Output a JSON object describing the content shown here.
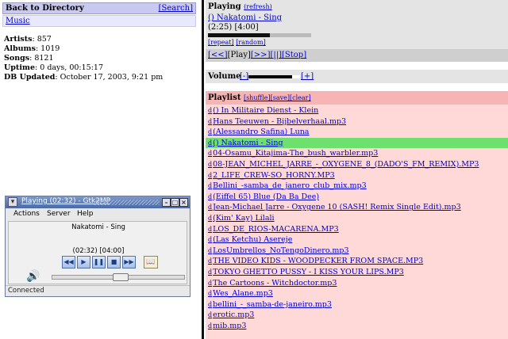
{
  "directory": {
    "back_label": "Back to Directory",
    "search_label": "[Search]",
    "music_label": "Music"
  },
  "stats": [
    {
      "label": "Artists",
      "value": ": 857"
    },
    {
      "label": "Albums",
      "value": ": 1019"
    },
    {
      "label": "Songs",
      "value": ": 8121"
    },
    {
      "label": "Uptime",
      "value": ": 0 days, 00:15:17"
    },
    {
      "label": "DB Updated",
      "value": ": October 17, 2003, 9:21 pm"
    }
  ],
  "gtk2mp": {
    "window_title": "Playing (02:32) - Gtk2MP",
    "menu": [
      "Actions",
      "Server",
      "Help"
    ],
    "track": "Nakatomi - Sing",
    "time": "(02:32) [04:00]",
    "status": "Connected",
    "volume_level": 0.52
  },
  "playing": {
    "heading": "Playing",
    "refresh_label": "(refresh)",
    "track": "() Nakatomi - Sing",
    "times": "(2:25) [4:00]",
    "progress": 0.6,
    "repeat_label": "[repeat]",
    "random_label": "[random]"
  },
  "controls": {
    "prev": "[<<]",
    "play": "[Play]",
    "next": "[>>]",
    "pause": "[||]",
    "stop": "[Stop]"
  },
  "volume": {
    "label": "Volume",
    "minus": "[-]",
    "plus": "[+]",
    "level": 0.85
  },
  "playlist": {
    "heading": "Playlist",
    "shuffle": "[shuffle]",
    "save": "[save]",
    "clear": "[clear]",
    "delete_marker": "d",
    "current_index": 3,
    "items": [
      "() In Militaire Dienst - Klein",
      "Hans Teeuwen - Bijbelverhaal.mp3",
      "(Alessandro Safina) Luna",
      "() Nakatomi - Sing",
      "04-Osamu_Kitajima-The_bush_warbler.mp3",
      "08-JEAN_MICHEL_JARRE_-_OXYGENE_8_(DADO'S_FM_REMIX).MP3",
      "2_LIFE_CREW-SO_HORNY.MP3",
      "Bellini_-samba_de_janero_club_mix.mp3",
      "(Eiffel 65) Blue (Da Ba Dee)",
      "Jean-Michael Jarre - Oxygene 10 (SASH! Remix Single Edit).mp3",
      "(Kim' Kay) Lilali",
      "LOS_DE_RIOS-MACARENA.MP3",
      "(Las Ketchu) Asereje",
      "LosUmbrellos_NoTengoDinero.mp3",
      "THE VIDEO KIDS - WOODPECKER FROM SPACE.MP3",
      "TOKYO GHETTO PUSSY - I KISS YOUR LIPS.MP3",
      "The Cartoons - Witchdoctor.mp3",
      "Wes_Alane.mp3",
      "bellini_-_samba-de-janeiro.mp3",
      "erotic.mp3",
      "mib.mp3"
    ]
  }
}
